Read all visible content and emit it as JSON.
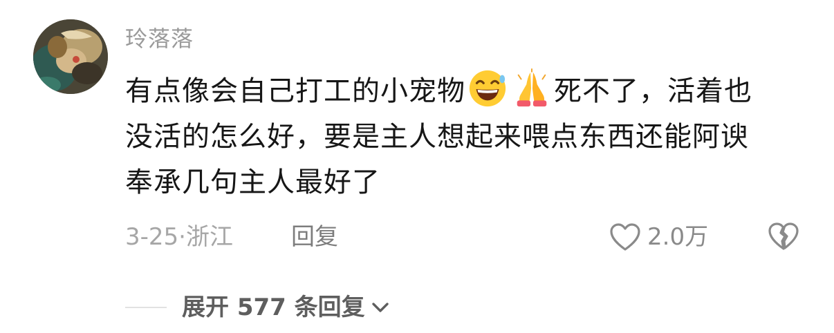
{
  "comment": {
    "username": "玲落落",
    "text_line1_a": "有点像会自己打工的小宠物",
    "text_line1_b": "死不了，活着也",
    "text_line2": "没活的怎么好，要是主人想起来喂点东西还能阿谀",
    "text_line3": "奉承几句主人最好了",
    "emojis": [
      "grinning-sweat-emoji",
      "folded-hands-emoji"
    ],
    "date": "3-25",
    "separator": "·",
    "location": "浙江",
    "reply_label": "回复",
    "like_count": "2.0万",
    "expand_label": "展开 577 条回复"
  },
  "icons": {
    "like": "heart-outline-icon",
    "dislike": "broken-heart-icon",
    "expand": "chevron-down-icon"
  },
  "colors": {
    "username": "#9a9a9a",
    "body_text": "#161616",
    "meta_text": "#a6a6a6",
    "action_text": "#7d7d7d"
  }
}
